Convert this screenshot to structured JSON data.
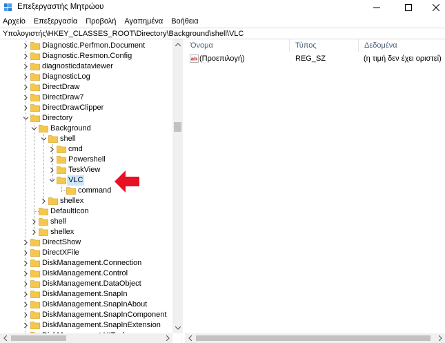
{
  "window": {
    "title": "Επεξεργαστής Μητρώου",
    "minimize_icon": "minimize-icon",
    "maximize_icon": "maximize-icon",
    "close_icon": "close-icon"
  },
  "menu": {
    "items": [
      "Αρχείο",
      "Επεξεργασία",
      "Προβολή",
      "Αγαπημένα",
      "Βοήθεια"
    ]
  },
  "address": {
    "path": "Υπολογιστής\\HKEY_CLASSES_ROOT\\Directory\\Background\\shell\\VLC"
  },
  "tree": {
    "items": [
      {
        "label": "Diagnostic.Perfmon.Document",
        "level": 0,
        "expander": "right"
      },
      {
        "label": "Diagnostic.Resmon.Config",
        "level": 0,
        "expander": "right"
      },
      {
        "label": "diagnosticdataviewer",
        "level": 0,
        "expander": "right"
      },
      {
        "label": "DiagnosticLog",
        "level": 0,
        "expander": "right"
      },
      {
        "label": "DirectDraw",
        "level": 0,
        "expander": "right"
      },
      {
        "label": "DirectDraw7",
        "level": 0,
        "expander": "right"
      },
      {
        "label": "DirectDrawClipper",
        "level": 0,
        "expander": "right"
      },
      {
        "label": "Directory",
        "level": 0,
        "expander": "down"
      },
      {
        "label": "Background",
        "level": 1,
        "expander": "down"
      },
      {
        "label": "shell",
        "level": 2,
        "expander": "down"
      },
      {
        "label": "cmd",
        "level": 3,
        "expander": "right"
      },
      {
        "label": "Powershell",
        "level": 3,
        "expander": "right"
      },
      {
        "label": "TeskView",
        "level": 3,
        "expander": "right"
      },
      {
        "label": "VLC",
        "level": 3,
        "expander": "down",
        "selected": true
      },
      {
        "label": "command",
        "level": 4,
        "expander": "none"
      },
      {
        "label": "shellex",
        "level": 2,
        "expander": "right"
      },
      {
        "label": "DefaultIcon",
        "level": 1,
        "expander": "none"
      },
      {
        "label": "shell",
        "level": 1,
        "expander": "right"
      },
      {
        "label": "shellex",
        "level": 1,
        "expander": "right"
      },
      {
        "label": "DirectShow",
        "level": 0,
        "expander": "right"
      },
      {
        "label": "DirectXFile",
        "level": 0,
        "expander": "right"
      },
      {
        "label": "DiskManagement.Connection",
        "level": 0,
        "expander": "right"
      },
      {
        "label": "DiskManagement.Control",
        "level": 0,
        "expander": "right"
      },
      {
        "label": "DiskManagement.DataObject",
        "level": 0,
        "expander": "right"
      },
      {
        "label": "DiskManagement.SnapIn",
        "level": 0,
        "expander": "right"
      },
      {
        "label": "DiskManagement.SnapInAbout",
        "level": 0,
        "expander": "right"
      },
      {
        "label": "DiskManagement.SnapInComponent",
        "level": 0,
        "expander": "right"
      },
      {
        "label": "DiskManagement.SnapInExtension",
        "level": 0,
        "expander": "right"
      },
      {
        "label": "DiskManagement.UITasks",
        "level": 0,
        "expander": "right"
      }
    ]
  },
  "values_list": {
    "columns": [
      "Όνομα",
      "Τύπος",
      "Δεδομένα"
    ],
    "rows": [
      {
        "name": "(Προεπιλογή)",
        "type": "REG_SZ",
        "data": "(η τιμή δεν έχει οριστεί)",
        "icon": "string-value-icon"
      }
    ]
  },
  "colors": {
    "folder": "#f5c84c",
    "selection": "#cce8ff",
    "annotation_arrow": "#e81123",
    "header_text": "#4c607a"
  }
}
